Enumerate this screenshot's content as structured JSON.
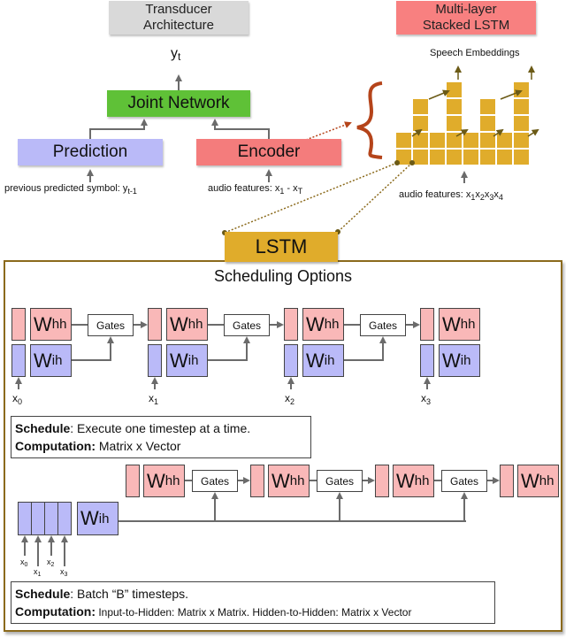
{
  "transducer": {
    "header": "Transducer Architecture",
    "output_label": "y",
    "output_sub": "t",
    "joint_network": "Joint Network",
    "prediction": "Prediction",
    "encoder": "Encoder",
    "prediction_input": "previous predicted symbol: y",
    "prediction_input_sub": "t-1",
    "encoder_input": "audio features: x",
    "encoder_input_sub1": "1",
    "encoder_input_mid": " - x",
    "encoder_input_sub2": "T"
  },
  "stacked_lstm": {
    "header": "Multi-layer Stacked LSTM",
    "output_label": "Speech Embeddings",
    "input_label": "audio features: x",
    "input_subs": [
      "1",
      "2",
      "3",
      "4"
    ]
  },
  "lstm_label": "LSTM",
  "scheduling": {
    "title": "Scheduling Options",
    "weights": {
      "hh": "W",
      "hh_sub": "hh",
      "ih": "W",
      "ih_sub": "ih"
    },
    "gates_label": "Gates",
    "option1": {
      "inputs": [
        {
          "x": "x",
          "sub": "0"
        },
        {
          "x": "x",
          "sub": "1"
        },
        {
          "x": "x",
          "sub": "2"
        },
        {
          "x": "x",
          "sub": "3"
        }
      ],
      "schedule_key": "Schedule",
      "schedule_text": ": Execute one timestep at a time.",
      "computation_key": "Computation:",
      "computation_text": " Matrix x Vector"
    },
    "option2": {
      "inputs": [
        {
          "x": "x",
          "sub": "0"
        },
        {
          "x": "x",
          "sub": "1"
        },
        {
          "x": "x",
          "sub": "2"
        },
        {
          "x": "x",
          "sub": "3"
        }
      ],
      "schedule_key": "Schedule",
      "schedule_text": ": Batch “B” timesteps.",
      "computation_key": "Computation:",
      "computation_text": " Input-to-Hidden: Matrix x Matrix. Hidden-to-Hidden: Matrix x Vector"
    }
  },
  "colors": {
    "joint": "#5fc137",
    "prediction": "#babaf8",
    "encoder": "#f47c7c",
    "lstm": "#e0ac2b",
    "cell": "#e0ac2b",
    "brace": "#b5441a",
    "panel_border": "#8b6a1c"
  }
}
